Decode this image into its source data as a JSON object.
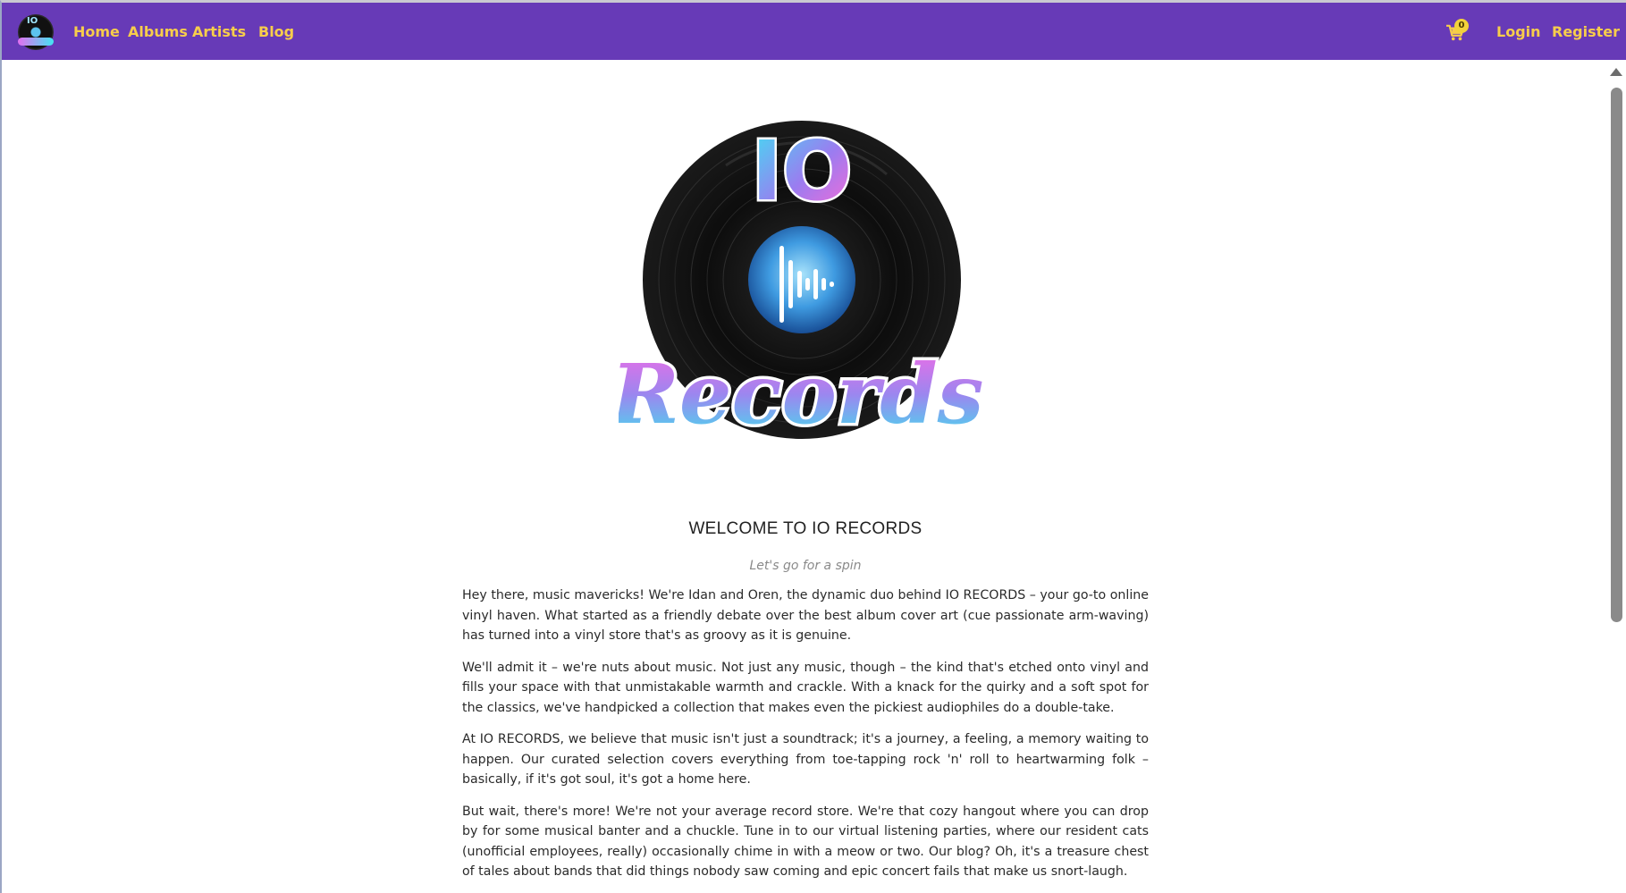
{
  "nav": {
    "links": [
      "Home",
      "Albums",
      "Artists",
      "Blog"
    ],
    "cart_count": "0",
    "login": "Login",
    "register": "Register"
  },
  "hero_logo": {
    "top_text": "IO",
    "bottom_text": "Records"
  },
  "main": {
    "title": "WELCOME TO IO RECORDS",
    "tagline": "Let's go for a spin",
    "paragraphs": [
      "Hey there, music mavericks! We're Idan and Oren, the dynamic duo behind IO RECORDS – your go-to online vinyl haven. What started as a friendly debate over the best album cover art (cue passionate arm-waving) has turned into a vinyl store that's as groovy as it is genuine.",
      "We'll admit it – we're nuts about music. Not just any music, though – the kind that's etched onto vinyl and fills your space with that unmistakable warmth and crackle. With a knack for the quirky and a soft spot for the classics, we've handpicked a collection that makes even the pickiest audiophiles do a double-take.",
      "At IO RECORDS, we believe that music isn't just a soundtrack; it's a journey, a feeling, a memory waiting to happen. Our curated selection covers everything from toe-tapping rock 'n' roll to heartwarming folk – basically, if it's got soul, it's got a home here.",
      "But wait, there's more! We're not your average record store. We're that cozy hangout where you can drop by for some musical banter and a chuckle. Tune in to our virtual listening parties, where our resident cats (unofficial employees, really) occasionally chime in with a meow or two. Our blog? Oh, it's a treasure chest of tales about bands that did things nobody saw coming and epic concert fails that make us snort-laugh."
    ]
  },
  "colors": {
    "navbar": "#673ab7",
    "nav_link": "#f7cd4b",
    "badge": "#f3d23b"
  },
  "icons": [
    "site-logo-icon",
    "cart-icon",
    "sound-wave-icon"
  ]
}
